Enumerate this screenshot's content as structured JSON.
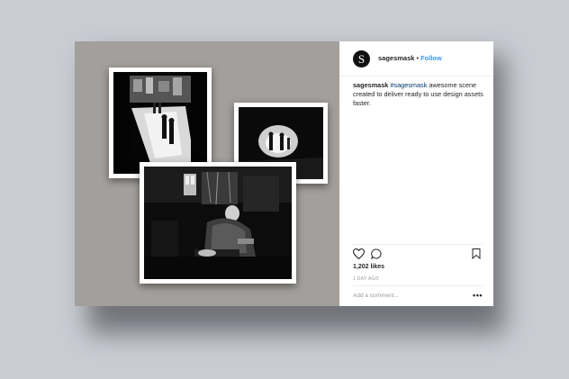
{
  "post": {
    "avatar_letter": "S",
    "username": "sagesmask",
    "separator": "•",
    "follow_label": "Follow",
    "caption_user": "sagesmask",
    "caption_tag": "#sagesmask",
    "caption_text": " awesome scene created to deliver ready to use design assets faster.",
    "likes": "1,202 likes",
    "timestamp": "1 DAY AGO",
    "comment_placeholder": "Add a comment...",
    "more_label": "•••"
  },
  "icons": {
    "like": "heart-icon",
    "comment": "comment-icon",
    "save": "bookmark-icon",
    "more": "more-options-icon"
  },
  "colors": {
    "background": "#c9ccd3",
    "mockup_area": "#a29f9c",
    "follow": "#3897f0",
    "hashtag": "#003569"
  }
}
